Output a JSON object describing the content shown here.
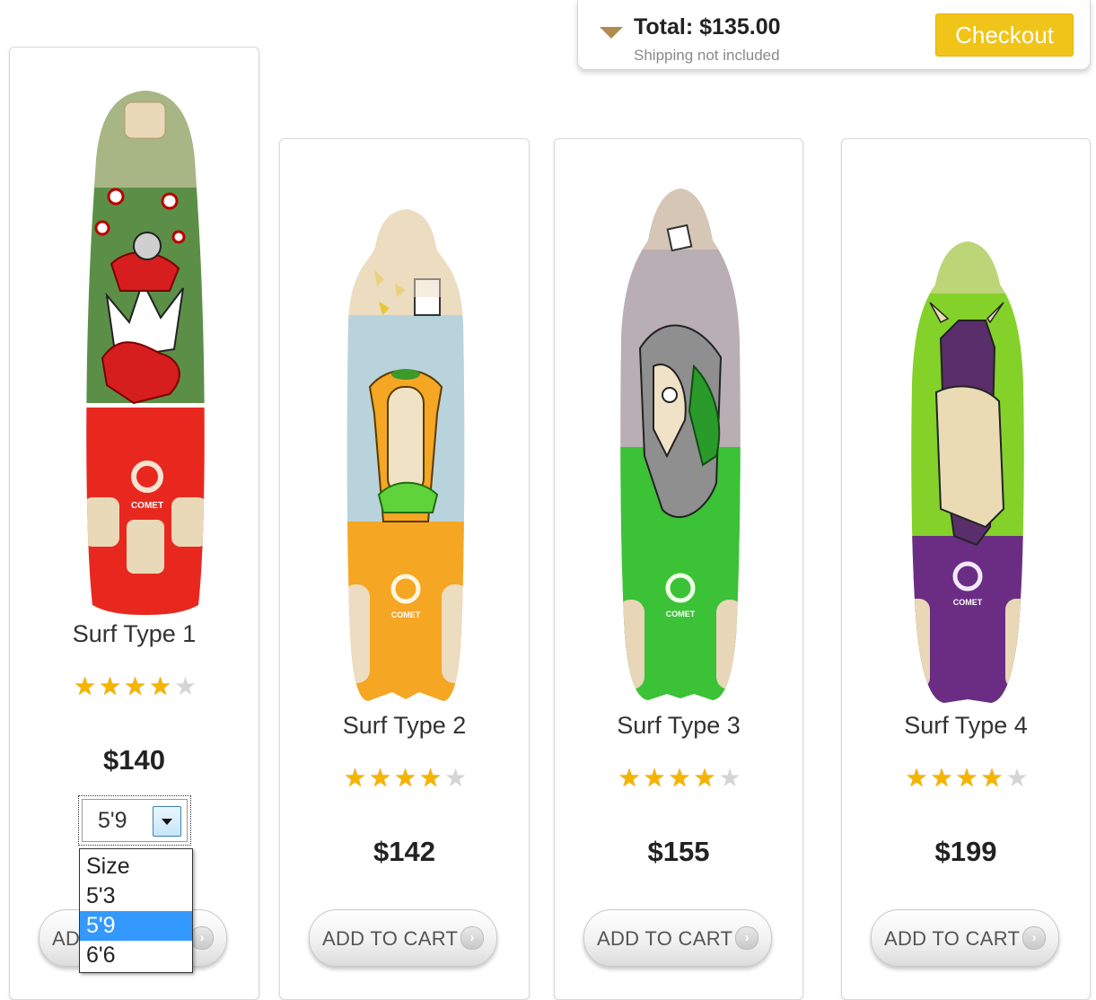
{
  "cart": {
    "total": "Total: $135.00",
    "shipping_note": "Shipping not included",
    "checkout_label": "Checkout"
  },
  "colors": {
    "accent": "#f0c419",
    "star_on": "#f4b400",
    "star_off": "#d5d5d5",
    "dropdown_highlight": "#3399ff"
  },
  "products": [
    {
      "name": "Surf Type 1",
      "price": "$140",
      "rating": 4,
      "rating_max": 5,
      "brand": "COMET",
      "add_label": "ADD TO CART"
    },
    {
      "name": "Surf Type 2",
      "price": "$142",
      "rating": 4,
      "rating_max": 5,
      "brand": "COMET",
      "add_label": "ADD TO CART"
    },
    {
      "name": "Surf Type 3",
      "price": "$155",
      "rating": 4,
      "rating_max": 5,
      "brand": "COMET",
      "add_label": "ADD TO CART"
    },
    {
      "name": "Surf Type 4",
      "price": "$199",
      "rating": 4,
      "rating_max": 5,
      "brand": "COMET",
      "add_label": "ADD TO CART"
    }
  ],
  "size_select": {
    "value": "5'9",
    "options": [
      "Size",
      "5'3",
      "5'9",
      "6'6"
    ],
    "selected_index": 2
  }
}
